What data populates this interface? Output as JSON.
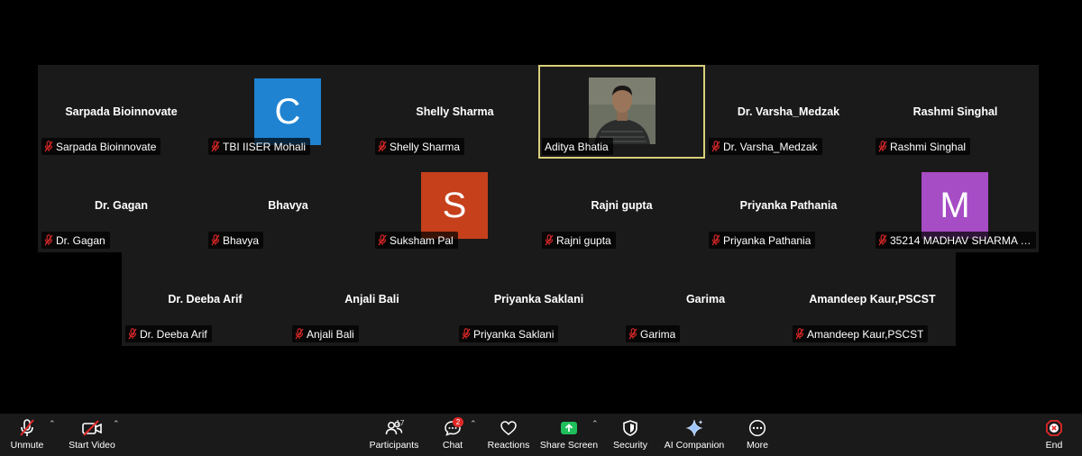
{
  "participants": [
    {
      "name": "Sarpada Bioinnovate",
      "center_name": "Sarpada Bioinnovate"
    },
    {
      "name": "TBI IISER Mohali",
      "avatar_letter": "C",
      "avatar_color": "#1f83d1"
    },
    {
      "name": "Shelly Sharma",
      "center_name": "Shelly Sharma"
    },
    {
      "name": "Aditya Bhatia",
      "active_speaker": true
    },
    {
      "name": "Dr. Varsha_Medzak",
      "center_name": "Dr. Varsha_Medzak"
    },
    {
      "name": "Rashmi Singhal",
      "center_name": "Rashmi Singhal"
    },
    {
      "name": "Dr. Gagan",
      "center_name": "Dr. Gagan"
    },
    {
      "name": "Bhavya",
      "center_name": "Bhavya"
    },
    {
      "name": "Suksham Pal",
      "avatar_letter": "S",
      "avatar_color": "#c6401c"
    },
    {
      "name": "Rajni gupta",
      "center_name": "Rajni gupta"
    },
    {
      "name": "Priyanka Pathania",
      "center_name": "Priyanka Pathania"
    },
    {
      "name": "35214 MADHAV SHARMA --...",
      "avatar_letter": "M",
      "avatar_color": "#a64cc4"
    },
    {
      "name": "Dr. Deeba Arif",
      "center_name": "Dr. Deeba Arif"
    },
    {
      "name": "Anjali Bali",
      "center_name": "Anjali Bali"
    },
    {
      "name": "Priyanka Saklani",
      "center_name": "Priyanka Saklani"
    },
    {
      "name": "Garima",
      "center_name": "Garima"
    },
    {
      "name": "Amandeep Kaur,PSCST",
      "center_name": "Amandeep Kaur,PSCST"
    }
  ],
  "toolbar": {
    "unmute": "Unmute",
    "start_video": "Start Video",
    "participants": "Participants",
    "participants_count": "17",
    "chat": "Chat",
    "chat_badge": "2",
    "reactions": "Reactions",
    "share_screen": "Share Screen",
    "security": "Security",
    "ai_companion": "AI Companion",
    "more": "More",
    "end": "End"
  },
  "colors": {
    "tile_bg": "#1a1a1a",
    "active_border": "#d7d07a",
    "mute_red": "#e02828",
    "share_green": "#1fbf5c",
    "end_red": "#e02828"
  }
}
